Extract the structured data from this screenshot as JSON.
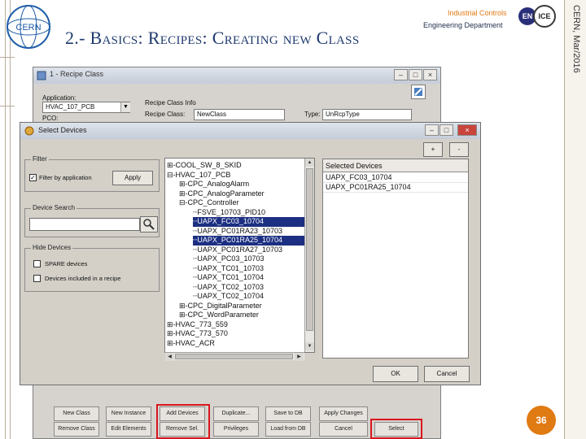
{
  "slide": {
    "title": "2.- Basics: Recipes: Creating new Class",
    "dept_top": "Industrial Controls",
    "dept_bottom": "Engineering Department",
    "en_badge": "EN",
    "ice_badge": "ICE",
    "side_text": "CERN, Mar/2016",
    "page_number": "36",
    "logo_text": "CERN",
    "accent_color": "#e07a12",
    "title_color": "#1f3b6e"
  },
  "recipe_window": {
    "title": "1 - Recipe Class",
    "application_label": "Application:",
    "application_value": "HVAC_107_PCB",
    "pco_label": "PCO:",
    "class_info_label": "Recipe Class Info",
    "recipe_class_label": "Recipe Class:",
    "recipe_class_value": "NewClass",
    "type_label": "Type:",
    "type_value": "UnRcpType",
    "buttons_row1": [
      "New Class",
      "New Instance",
      "Add Devices",
      "Duplicate...",
      "Save to DB",
      "Apply Changes"
    ],
    "buttons_row2": [
      "Remove Class",
      "Edit Elements",
      "Remove Sel.",
      "Privileges",
      "Load from DB",
      "Cancel",
      "Select"
    ]
  },
  "dialog": {
    "title": "Select Devices",
    "filter_group": "Filter",
    "filter_checkbox": "Filter by application",
    "filter_checked": true,
    "apply_button": "Apply",
    "device_search_group": "Device Search",
    "search_value": "",
    "hide_devices_group": "Hide Devices",
    "spare_checkbox": "SPARE devices",
    "included_checkbox": "Devices included in a recipe",
    "add_button": "+",
    "remove_button": "-",
    "ok_button": "OK",
    "cancel_button": "Cancel",
    "tree": [
      {
        "text": "⊞-COOL_SW_8_SKID",
        "indent": 0,
        "selected": false
      },
      {
        "text": "⊟-HVAC_107_PCB",
        "indent": 0,
        "selected": false
      },
      {
        "text": "⊞-CPC_AnalogAlarm",
        "indent": 1,
        "selected": false
      },
      {
        "text": "⊞-CPC_AnalogParameter",
        "indent": 1,
        "selected": false
      },
      {
        "text": "⊟-CPC_Controller",
        "indent": 1,
        "selected": false
      },
      {
        "text": "┈FSVE_10703_PID10",
        "indent": 2,
        "selected": false
      },
      {
        "text": "┈UAPX_FC03_10704",
        "indent": 2,
        "selected": true
      },
      {
        "text": "┈UAPX_PC01RA23_10703",
        "indent": 2,
        "selected": false
      },
      {
        "text": "┈UAPX_PC01RA25_10704",
        "indent": 2,
        "selected": true
      },
      {
        "text": "┈UAPX_PC01RA27_10703",
        "indent": 2,
        "selected": false
      },
      {
        "text": "┈UAPX_PC03_10703",
        "indent": 2,
        "selected": false
      },
      {
        "text": "┈UAPX_TC01_10703",
        "indent": 2,
        "selected": false
      },
      {
        "text": "┈UAPX_TC01_10704",
        "indent": 2,
        "selected": false
      },
      {
        "text": "┈UAPX_TC02_10703",
        "indent": 2,
        "selected": false
      },
      {
        "text": "┈UAPX_TC02_10704",
        "indent": 2,
        "selected": false
      },
      {
        "text": "⊞-CPC_DigitalParameter",
        "indent": 1,
        "selected": false
      },
      {
        "text": "⊞-CPC_WordParameter",
        "indent": 1,
        "selected": false
      },
      {
        "text": "⊞-HVAC_773_559",
        "indent": 0,
        "selected": false
      },
      {
        "text": "⊞-HVAC_773_570",
        "indent": 0,
        "selected": false
      },
      {
        "text": "⊞-HVAC_ACR",
        "indent": 0,
        "selected": false
      }
    ],
    "selected_header": "Selected Devices",
    "selected_devices": [
      "UAPX_FC03_10704",
      "UAPX_PC01RA25_10704"
    ],
    "selection_color": "#1c2f82"
  }
}
